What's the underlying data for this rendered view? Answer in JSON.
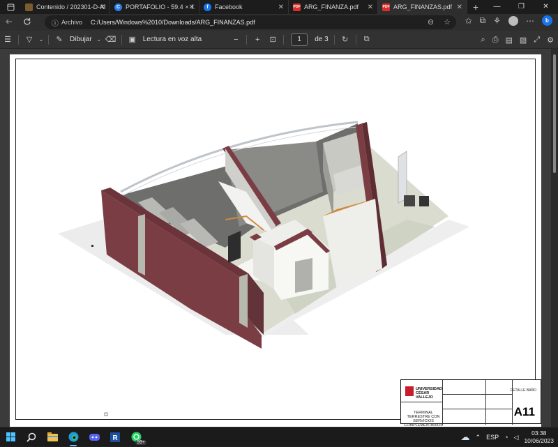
{
  "tabs": [
    {
      "label": "Contenido / 202301-D-AR",
      "favicon": "folder",
      "color": "#7a5c2e",
      "active": false
    },
    {
      "label": "PORTAFOLIO - 59.4 × 42c",
      "favicon": "C",
      "color": "#2b7de9",
      "active": false
    },
    {
      "label": "Facebook",
      "favicon": "f",
      "color": "#1877f2",
      "active": false
    },
    {
      "label": "ARG_FINANZA.pdf",
      "favicon": "PDF",
      "color": "#d9302c",
      "active": false
    },
    {
      "label": "ARG_FINANZAS.pdf",
      "favicon": "PDF",
      "color": "#d9302c",
      "active": true
    }
  ],
  "newtab_label": "+",
  "window_controls": {
    "minimize": "—",
    "maximize": "❐",
    "close": "✕"
  },
  "address": {
    "info_icon": "ⓘ",
    "scheme_label": "Archivo",
    "url": "C:/Users/Windows%2010/Downloads/ARG_FINANZAS.pdf"
  },
  "pdf_toolbar": {
    "draw_label": "Dibujar",
    "read_aloud_label": "Lectura en voz alta",
    "zoom_out": "−",
    "zoom_in": "+",
    "page_current": "1",
    "page_total": "de 3"
  },
  "titleblock": {
    "university": "UNIVERSIDAD CÉSAR VALLEJO",
    "project": "TERMINAL TERRESTRE CON SERVICIOS COMPLEMENTARIOS",
    "sheet_title": "DETALLE BAÑO",
    "sheet_number": "A11"
  },
  "taskbar": {
    "badge": "99+",
    "lang": "ESP",
    "time": "03:38",
    "date": "10/06/2023"
  },
  "colors": {
    "brick": "#7a3d44",
    "wall": "#eeeeea",
    "floor": "#d9dccf",
    "trim": "#d08a3c"
  }
}
